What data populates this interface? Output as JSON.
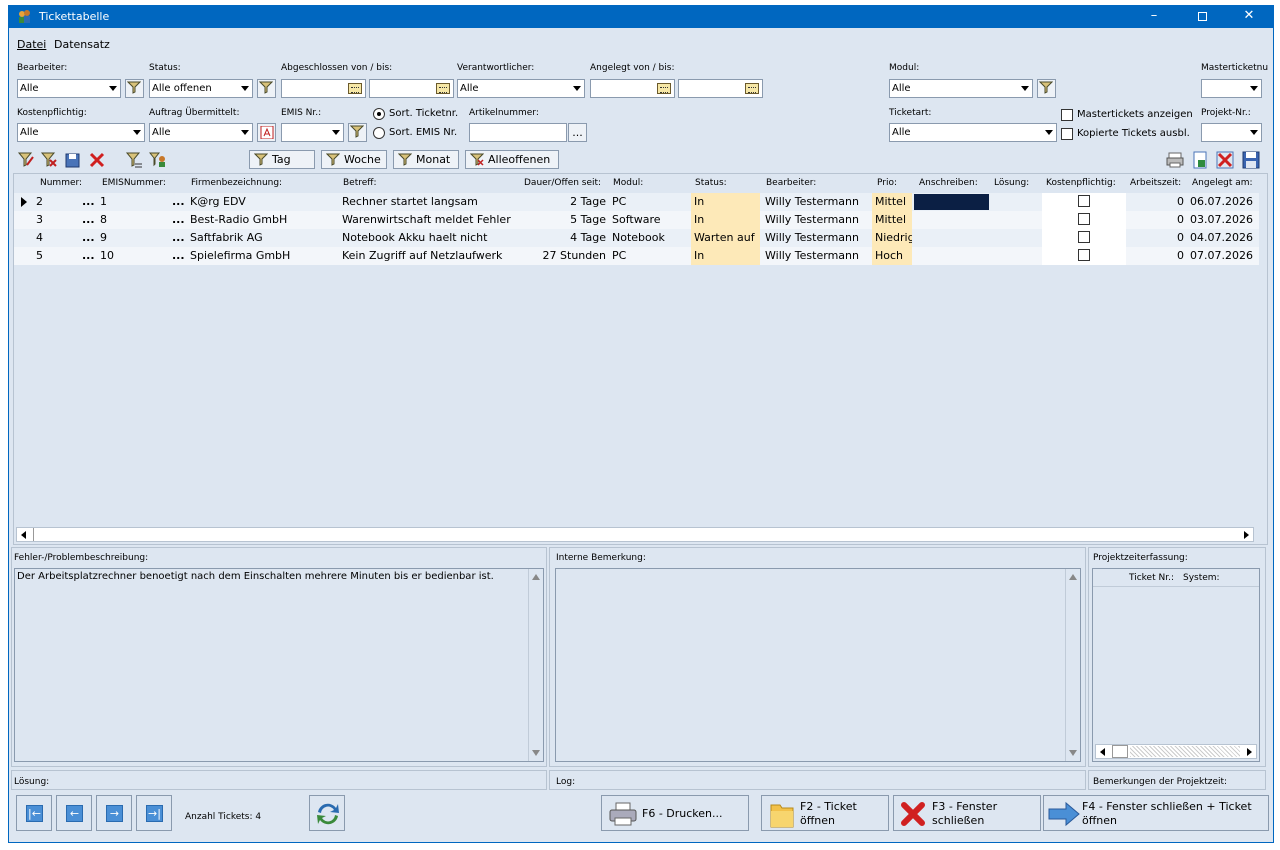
{
  "window": {
    "title": "Tickettabelle"
  },
  "menu": [
    "Datei",
    "Datensatz"
  ],
  "filters": {
    "bearbeiter_label": "Bearbeiter:",
    "bearbeiter_value": "Alle",
    "status_label": "Status:",
    "status_value": "Alle offenen",
    "abgeschlossen_label": "Abgeschlossen von / bis:",
    "verantwortlicher_label": "Verantwortlicher:",
    "verantwortlicher_value": "Alle",
    "angelegt_label": "Angelegt von / bis:",
    "modul_label": "Modul:",
    "modul_value": "Alle",
    "masterticket_label": "Masterticketnu",
    "kosten_label": "Kostenpflichtig:",
    "kosten_value": "Alle",
    "auftrag_label": "Auftrag Übermittelt:",
    "auftrag_value": "Alle",
    "emis_label": "EMIS Nr.:",
    "sort_ticket": "Sort. Ticketnr.",
    "sort_emis": "Sort. EMIS Nr.",
    "artikel_label": "Artikelnummer:",
    "artikel_btn": "...",
    "ticketart_label": "Ticketart:",
    "ticketart_value": "Alle",
    "mastertickets_anzeigen": "Mastertickets anzeigen",
    "kopierte_tickets": "Kopierte Tickets ausbl.",
    "projekt_label": "Projekt-Nr.:"
  },
  "toolbar": {
    "tag": "Tag",
    "woche": "Woche",
    "monat": "Monat",
    "alleoffenen": "Alleoffenen"
  },
  "grid": {
    "headers": [
      "Nummer:",
      "EMISNummer:",
      "Firmenbezeichnung:",
      "Betreff:",
      "Dauer/Offen seit:",
      "Modul:",
      "Status:",
      "Bearbeiter:",
      "Prio:",
      "Anschreiben:",
      "Lösung:",
      "Kostenpflichtig:",
      "Arbeitszeit:",
      "Angelegt am:"
    ],
    "rows": [
      {
        "nummer": "2",
        "dots1": "...",
        "emis": "1",
        "dots2": "...",
        "firma": "K@rg EDV",
        "betreff": "Rechner startet langsam",
        "dauer": "2 Tage",
        "modul": "PC",
        "status": "In",
        "bearbeiter": "Willy Testermann",
        "prio": "Mittel",
        "arbeitszeit": "0",
        "angelegt": "06.07.2026"
      },
      {
        "nummer": "3",
        "dots1": "...",
        "emis": "8",
        "dots2": "...",
        "firma": "Best-Radio GmbH",
        "betreff": "Warenwirtschaft meldet Fehler",
        "dauer": "5 Tage",
        "modul": "Software",
        "status": "In",
        "bearbeiter": "Willy Testermann",
        "prio": "Mittel",
        "arbeitszeit": "0",
        "angelegt": "03.07.2026"
      },
      {
        "nummer": "4",
        "dots1": "...",
        "emis": "9",
        "dots2": "...",
        "firma": "Saftfabrik AG",
        "betreff": "Notebook Akku haelt nicht",
        "dauer": "4 Tage",
        "modul": "Notebook",
        "status": "Warten auf",
        "bearbeiter": "Willy Testermann",
        "prio": "Niedrig",
        "arbeitszeit": "0",
        "angelegt": "04.07.2026"
      },
      {
        "nummer": "5",
        "dots1": "...",
        "emis": "10",
        "dots2": "...",
        "firma": "Spielefirma GmbH",
        "betreff": "Kein Zugriff auf Netzlaufwerk",
        "dauer": "27 Stunden",
        "modul": "PC",
        "status": "In",
        "bearbeiter": "Willy Testermann",
        "prio": "Hoch",
        "arbeitszeit": "0",
        "angelegt": "07.07.2026"
      }
    ]
  },
  "panels": {
    "fehler_title": "Fehler-/Problembeschreibung:",
    "fehler_text": "Der Arbeitsplatzrechner benoetigt nach dem Einschalten mehrere Minuten bis er bedienbar ist.",
    "interne_title": "Interne Bemerkung:",
    "projekt_title": "Projektzeiterfassung:",
    "projekt_col1": "Ticket Nr.:",
    "projekt_col2": "System:",
    "loesung_title": "Lösung:",
    "log_title": "Log:",
    "bemerkungen_title": "Bemerkungen der Projektzeit:"
  },
  "footer": {
    "anzahl": "Anzahl Tickets: 4",
    "drucken": "F6 - Drucken...",
    "ticket_oeffnen_1": "F2 - Ticket",
    "ticket_oeffnen_2": "öffnen",
    "fenster_schliessen_1": "F3 - Fenster",
    "fenster_schliessen_2": "schließen",
    "fenster_ticket_1": "F4 - Fenster schließen + Ticket",
    "fenster_ticket_2": "öffnen"
  },
  "colors": {
    "titlebar": "#0067c0",
    "background": "#dde6f1",
    "highlight": "#fde9b8",
    "selected": "#0b1f44"
  }
}
